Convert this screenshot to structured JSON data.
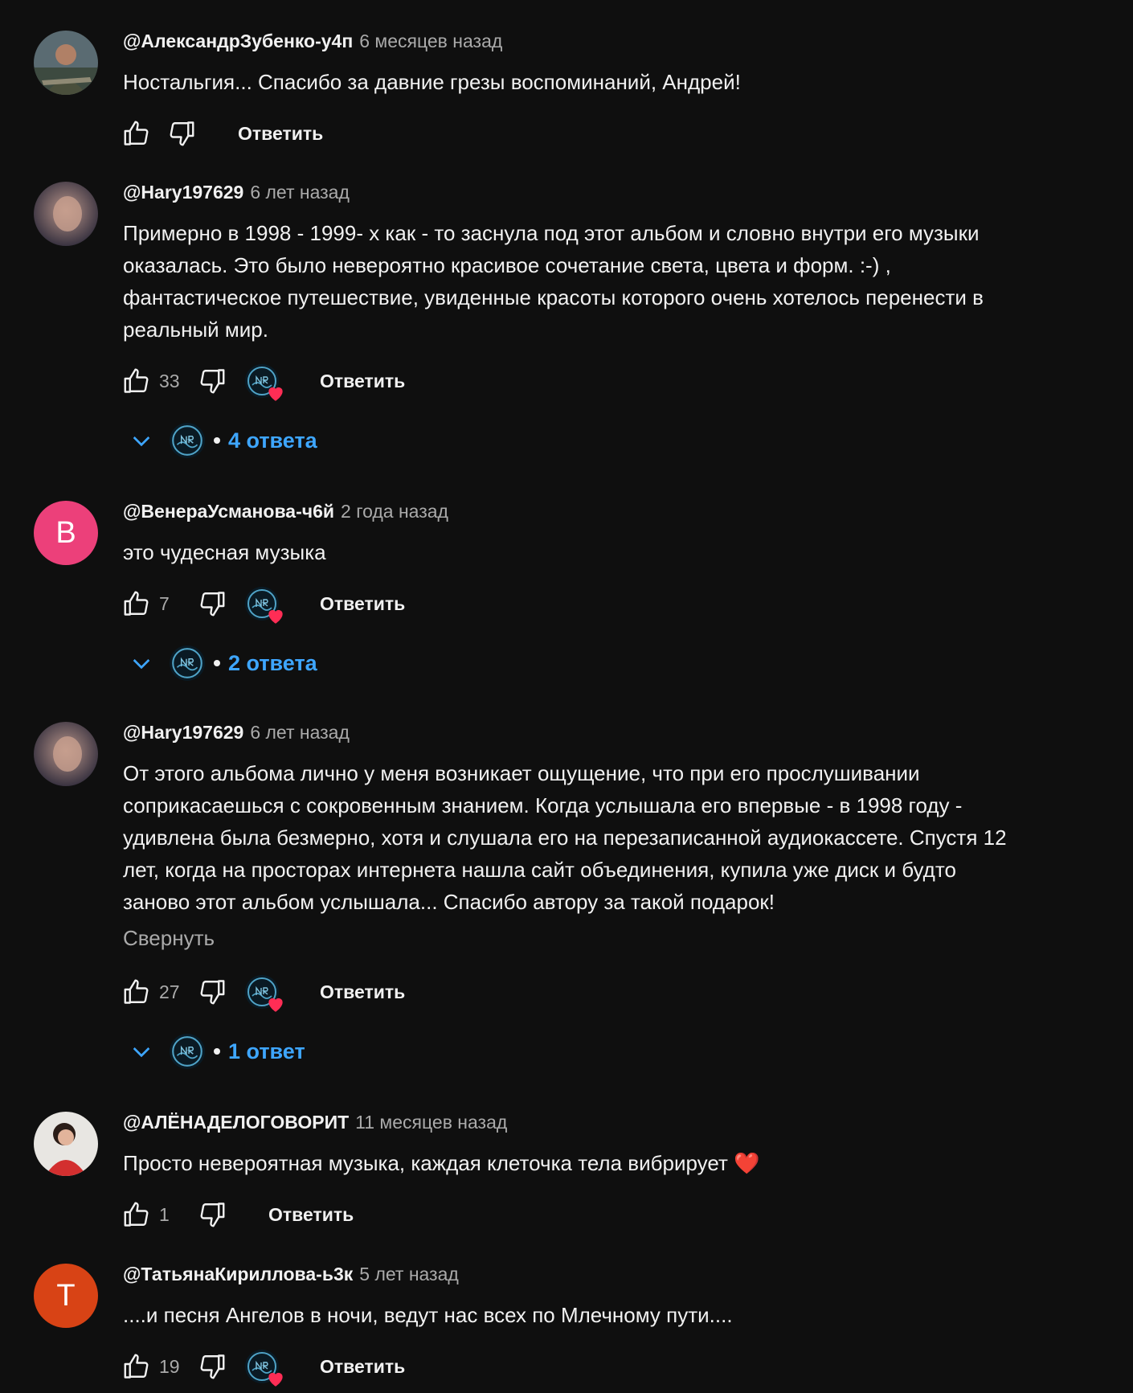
{
  "ui": {
    "reply_label": "Ответить",
    "collapse_label": "Свернуть"
  },
  "comments": [
    {
      "author": "@АлександрЗубенко-у4п",
      "time": "6 месяцев назад",
      "lines": [
        "Ностальгия... Спасибо за давние грезы воспоминаний, Андрей!"
      ],
      "likes": ""
    },
    {
      "author": "@Hary197629",
      "time": "6 лет назад",
      "lines": [
        "Примерно в 1998 - 1999- х как - то заснула под этот альбом и словно внутри его музыки",
        "оказалась. Это было невероятно красивое сочетание света, цвета и форм. :-) ,",
        "фантастическое путешествие, увиденные красоты которого очень хотелось перенести в",
        "реальный мир."
      ],
      "likes": "33",
      "replies": "4 ответа"
    },
    {
      "author": "@ВенераУсманова-ч6й",
      "time": "2 года назад",
      "avatar_letter": "B",
      "avatar_color": "#ec407a",
      "lines": [
        "это чудесная музыка"
      ],
      "likes": "7",
      "replies": "2 ответа"
    },
    {
      "author": "@Hary197629",
      "time": "6 лет назад",
      "lines": [
        "От этого альбома лично у меня возникает ощущение, что при его прослушивании",
        "соприкасаешься с сокровенным знанием. Когда услышала его впервые - в 1998 году -",
        "удивлена была безмерно, хотя и слушала его на перезаписанной аудиокассете. Спустя 12",
        "лет, когда на просторах интернета нашла сайт объединения,  купила уже диск и будто",
        "заново этот альбом услышала...  Спасибо автору за такой подарок!"
      ],
      "likes": "27",
      "replies": "1 ответ"
    },
    {
      "author": "@АЛЁНАДЕЛОГОВОРИТ",
      "time": "11 месяцев назад",
      "lines": [
        "Просто невероятная музыка, каждая клеточка тела вибрирует ❤️"
      ],
      "likes": "1"
    },
    {
      "author": "@ТатьянаКириллова-ь3к",
      "time": "5 лет назад",
      "avatar_letter": "T",
      "avatar_color": "#d84315",
      "lines": [
        "....и песня Ангелов в ночи, ведут нас всех по Млечному пути...."
      ],
      "likes": "19"
    }
  ]
}
